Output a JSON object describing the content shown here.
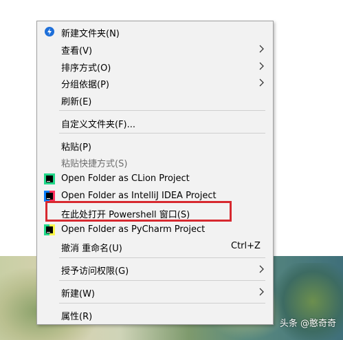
{
  "watermark": "头条 @憨奇奇",
  "menu": {
    "new_folder": "新建文件夹(N)",
    "view": "查看(V)",
    "sort_by": "排序方式(O)",
    "group_by": "分组依据(P)",
    "refresh": "刷新(E)",
    "customize_folder": "自定义文件夹(F)...",
    "paste": "粘贴(P)",
    "paste_shortcut": "粘贴快捷方式(S)",
    "open_clion": "Open Folder as CLion Project",
    "open_intellij": "Open Folder as IntelliJ IDEA Project",
    "open_powershell": "在此处打开 Powershell 窗口(S)",
    "open_pycharm": "Open Folder as PyCharm Project",
    "undo_rename": "撤消 重命名(U)",
    "undo_shortcut": "Ctrl+Z",
    "grant_access": "授予访问权限(G)",
    "new": "新建(W)",
    "properties": "属性(R)"
  },
  "icons": {
    "new_folder": "blue-circle-icon",
    "clion": "clion-icon",
    "intellij": "intellij-icon",
    "pycharm": "pycharm-icon"
  },
  "colors": {
    "menu_bg": "#f2f2f2",
    "highlight_border": "#d7282f"
  }
}
